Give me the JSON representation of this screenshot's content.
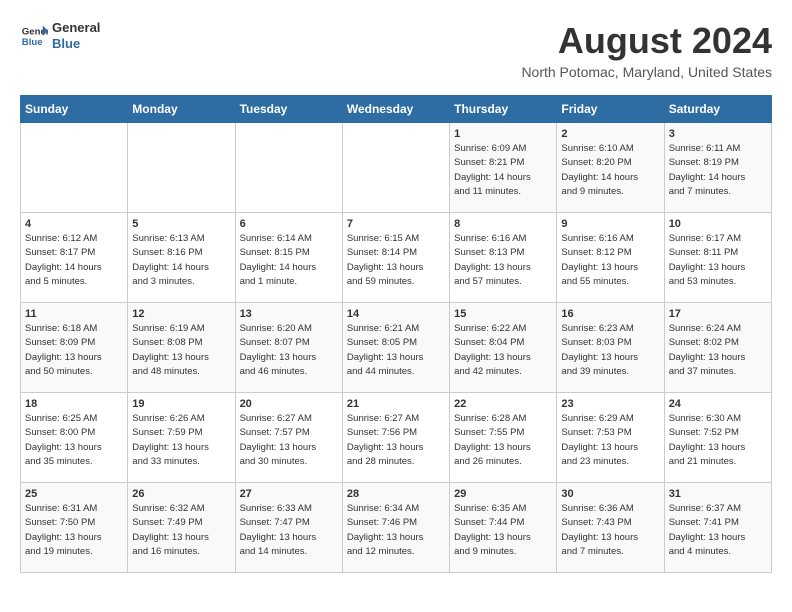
{
  "header": {
    "logo_general": "General",
    "logo_blue": "Blue",
    "month_year": "August 2024",
    "location": "North Potomac, Maryland, United States"
  },
  "days_of_week": [
    "Sunday",
    "Monday",
    "Tuesday",
    "Wednesday",
    "Thursday",
    "Friday",
    "Saturday"
  ],
  "weeks": [
    [
      {
        "day": "",
        "info": ""
      },
      {
        "day": "",
        "info": ""
      },
      {
        "day": "",
        "info": ""
      },
      {
        "day": "",
        "info": ""
      },
      {
        "day": "1",
        "info": "Sunrise: 6:09 AM\nSunset: 8:21 PM\nDaylight: 14 hours\nand 11 minutes."
      },
      {
        "day": "2",
        "info": "Sunrise: 6:10 AM\nSunset: 8:20 PM\nDaylight: 14 hours\nand 9 minutes."
      },
      {
        "day": "3",
        "info": "Sunrise: 6:11 AM\nSunset: 8:19 PM\nDaylight: 14 hours\nand 7 minutes."
      }
    ],
    [
      {
        "day": "4",
        "info": "Sunrise: 6:12 AM\nSunset: 8:17 PM\nDaylight: 14 hours\nand 5 minutes."
      },
      {
        "day": "5",
        "info": "Sunrise: 6:13 AM\nSunset: 8:16 PM\nDaylight: 14 hours\nand 3 minutes."
      },
      {
        "day": "6",
        "info": "Sunrise: 6:14 AM\nSunset: 8:15 PM\nDaylight: 14 hours\nand 1 minute."
      },
      {
        "day": "7",
        "info": "Sunrise: 6:15 AM\nSunset: 8:14 PM\nDaylight: 13 hours\nand 59 minutes."
      },
      {
        "day": "8",
        "info": "Sunrise: 6:16 AM\nSunset: 8:13 PM\nDaylight: 13 hours\nand 57 minutes."
      },
      {
        "day": "9",
        "info": "Sunrise: 6:16 AM\nSunset: 8:12 PM\nDaylight: 13 hours\nand 55 minutes."
      },
      {
        "day": "10",
        "info": "Sunrise: 6:17 AM\nSunset: 8:11 PM\nDaylight: 13 hours\nand 53 minutes."
      }
    ],
    [
      {
        "day": "11",
        "info": "Sunrise: 6:18 AM\nSunset: 8:09 PM\nDaylight: 13 hours\nand 50 minutes."
      },
      {
        "day": "12",
        "info": "Sunrise: 6:19 AM\nSunset: 8:08 PM\nDaylight: 13 hours\nand 48 minutes."
      },
      {
        "day": "13",
        "info": "Sunrise: 6:20 AM\nSunset: 8:07 PM\nDaylight: 13 hours\nand 46 minutes."
      },
      {
        "day": "14",
        "info": "Sunrise: 6:21 AM\nSunset: 8:05 PM\nDaylight: 13 hours\nand 44 minutes."
      },
      {
        "day": "15",
        "info": "Sunrise: 6:22 AM\nSunset: 8:04 PM\nDaylight: 13 hours\nand 42 minutes."
      },
      {
        "day": "16",
        "info": "Sunrise: 6:23 AM\nSunset: 8:03 PM\nDaylight: 13 hours\nand 39 minutes."
      },
      {
        "day": "17",
        "info": "Sunrise: 6:24 AM\nSunset: 8:02 PM\nDaylight: 13 hours\nand 37 minutes."
      }
    ],
    [
      {
        "day": "18",
        "info": "Sunrise: 6:25 AM\nSunset: 8:00 PM\nDaylight: 13 hours\nand 35 minutes."
      },
      {
        "day": "19",
        "info": "Sunrise: 6:26 AM\nSunset: 7:59 PM\nDaylight: 13 hours\nand 33 minutes."
      },
      {
        "day": "20",
        "info": "Sunrise: 6:27 AM\nSunset: 7:57 PM\nDaylight: 13 hours\nand 30 minutes."
      },
      {
        "day": "21",
        "info": "Sunrise: 6:27 AM\nSunset: 7:56 PM\nDaylight: 13 hours\nand 28 minutes."
      },
      {
        "day": "22",
        "info": "Sunrise: 6:28 AM\nSunset: 7:55 PM\nDaylight: 13 hours\nand 26 minutes."
      },
      {
        "day": "23",
        "info": "Sunrise: 6:29 AM\nSunset: 7:53 PM\nDaylight: 13 hours\nand 23 minutes."
      },
      {
        "day": "24",
        "info": "Sunrise: 6:30 AM\nSunset: 7:52 PM\nDaylight: 13 hours\nand 21 minutes."
      }
    ],
    [
      {
        "day": "25",
        "info": "Sunrise: 6:31 AM\nSunset: 7:50 PM\nDaylight: 13 hours\nand 19 minutes."
      },
      {
        "day": "26",
        "info": "Sunrise: 6:32 AM\nSunset: 7:49 PM\nDaylight: 13 hours\nand 16 minutes."
      },
      {
        "day": "27",
        "info": "Sunrise: 6:33 AM\nSunset: 7:47 PM\nDaylight: 13 hours\nand 14 minutes."
      },
      {
        "day": "28",
        "info": "Sunrise: 6:34 AM\nSunset: 7:46 PM\nDaylight: 13 hours\nand 12 minutes."
      },
      {
        "day": "29",
        "info": "Sunrise: 6:35 AM\nSunset: 7:44 PM\nDaylight: 13 hours\nand 9 minutes."
      },
      {
        "day": "30",
        "info": "Sunrise: 6:36 AM\nSunset: 7:43 PM\nDaylight: 13 hours\nand 7 minutes."
      },
      {
        "day": "31",
        "info": "Sunrise: 6:37 AM\nSunset: 7:41 PM\nDaylight: 13 hours\nand 4 minutes."
      }
    ]
  ]
}
